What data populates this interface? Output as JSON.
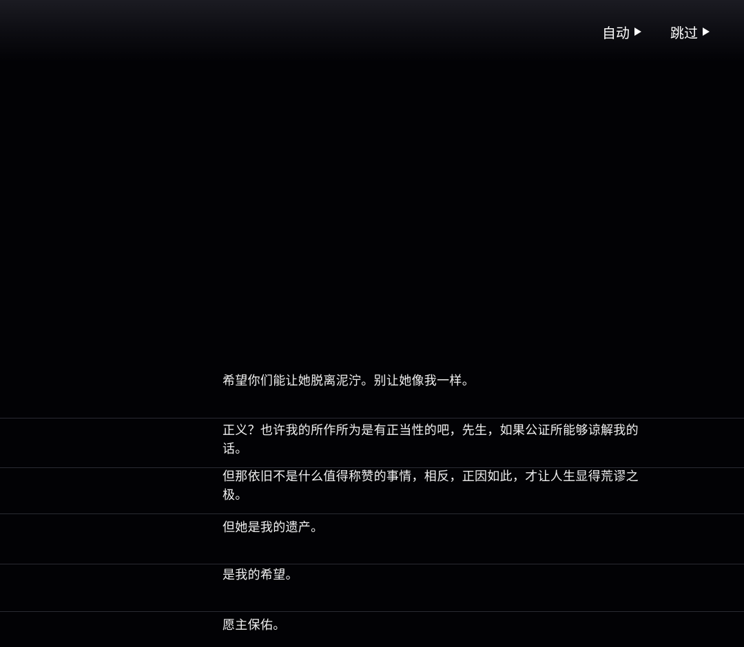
{
  "controls": {
    "auto_label": "自动",
    "skip_label": "跳过"
  },
  "dialogue_log": [
    "希望你们能让她脱离泥泞。别让她像我一样。",
    "正义？也许我的所作所为是有正当性的吧，先生，如果公证所能够谅解我的话。",
    "但那依旧不是什么值得称赞的事情，相反，正因如此，才让人生显得荒谬之极。",
    "但她是我的遗产。",
    "是我的希望。",
    "愿主保佑。"
  ]
}
